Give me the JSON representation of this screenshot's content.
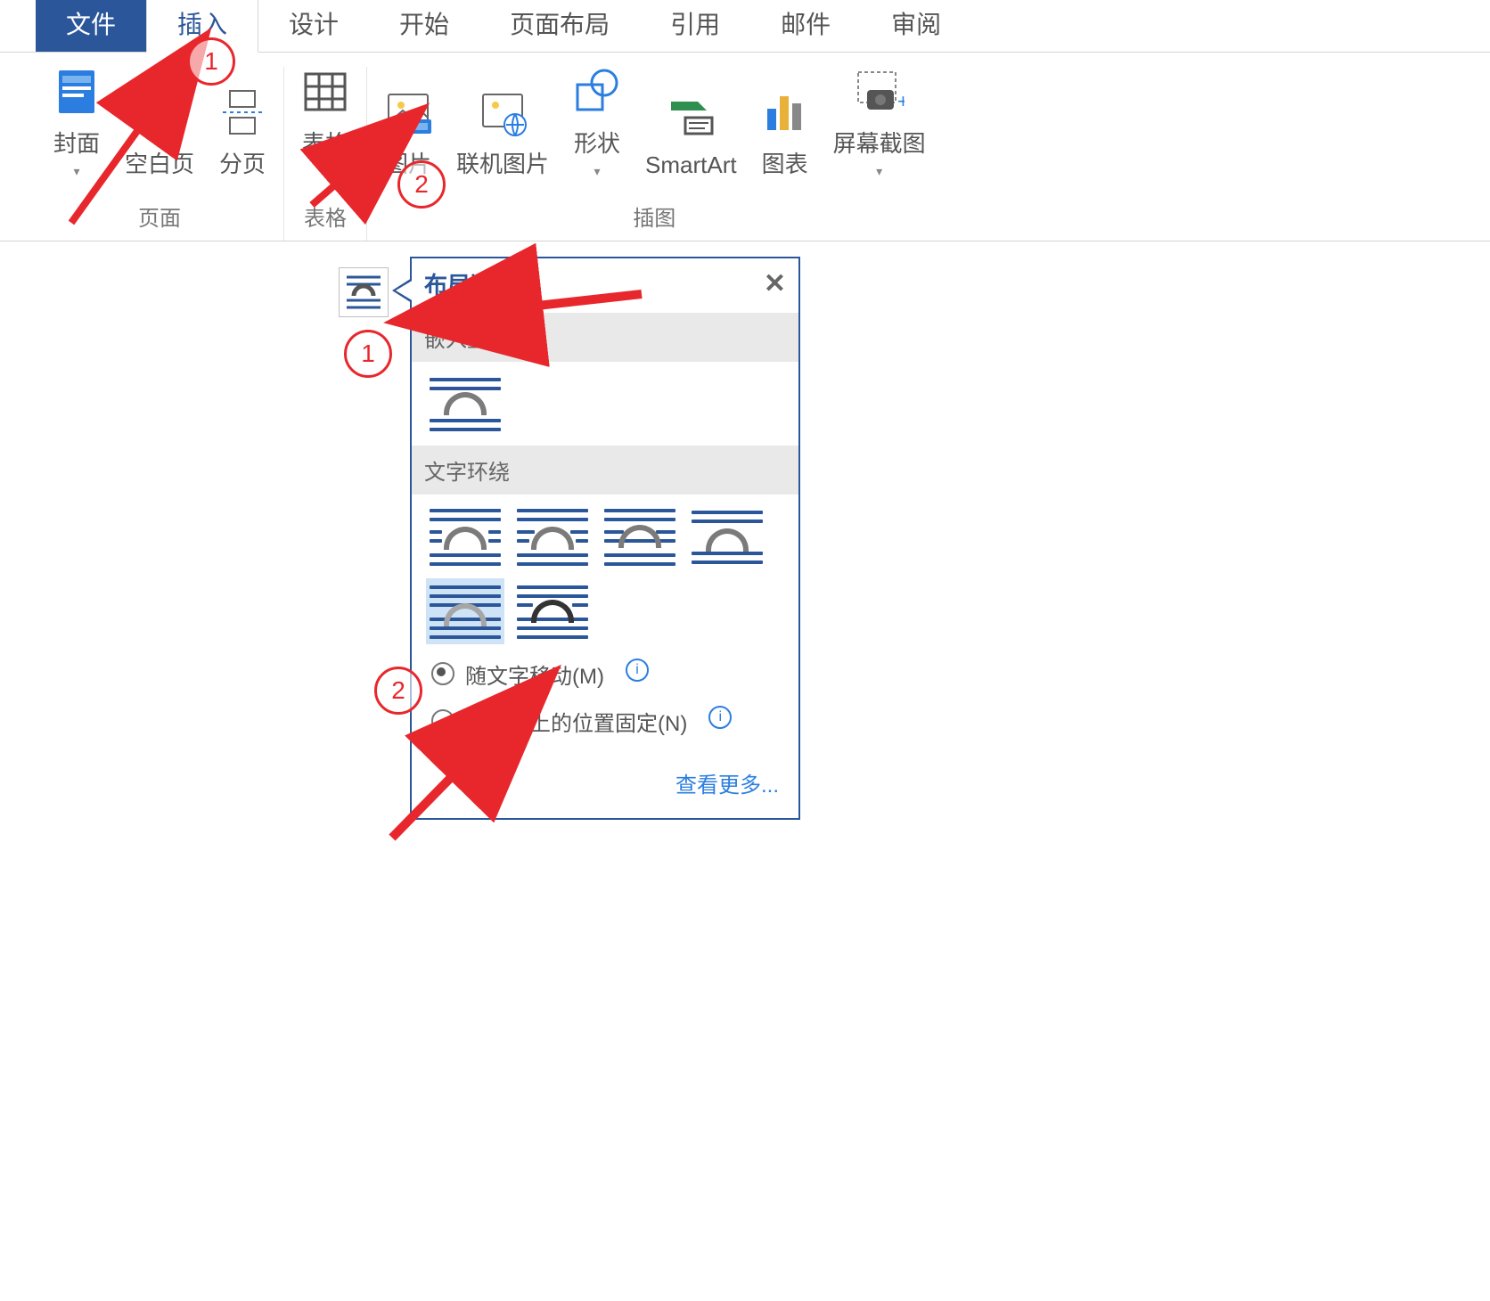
{
  "tabs": {
    "file": "文件",
    "insert": "插入",
    "design": "设计",
    "home": "开始",
    "layout": "页面布局",
    "references": "引用",
    "mailings": "邮件",
    "review": "审阅"
  },
  "groups": {
    "pages": {
      "label": "页面",
      "cover": "封面",
      "blank": "空白页",
      "break": "分页"
    },
    "tables": {
      "label": "表格",
      "table": "表格"
    },
    "illustrations": {
      "label": "插图",
      "picture": "图片",
      "onlinePicture": "联机图片",
      "shapes": "形状",
      "smartart": "SmartArt",
      "chart": "图表",
      "screenshot": "屏幕截图"
    }
  },
  "popup": {
    "title": "布局选项",
    "section1": "嵌入型",
    "section2": "文字环绕",
    "radio1": "随文字移动(M)",
    "radio2": "在页面上的位置固定(N)",
    "more": "查看更多..."
  },
  "anno": {
    "one": "1",
    "two": "2"
  }
}
